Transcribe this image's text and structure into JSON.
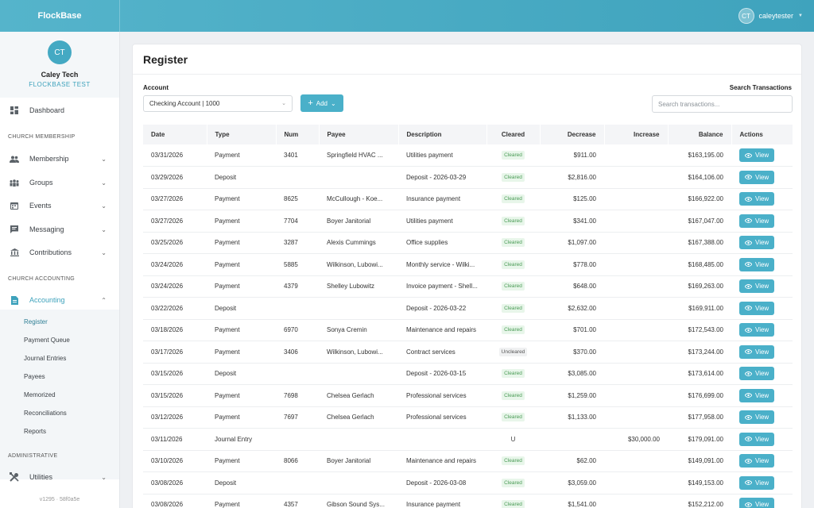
{
  "app": {
    "brand": "FlockBase"
  },
  "user": {
    "initials": "CT",
    "name": "caleytester"
  },
  "org": {
    "initials": "CT",
    "name": "Caley Tech",
    "subtitle": "FLOCKBASE TEST"
  },
  "nav": {
    "dashboard": "Dashboard",
    "sections": {
      "membership": "CHURCH MEMBERSHIP",
      "accounting": "CHURCH ACCOUNTING",
      "admin": "ADMINISTRATIVE"
    },
    "membership": "Membership",
    "groups": "Groups",
    "events": "Events",
    "messaging": "Messaging",
    "contributions": "Contributions",
    "accounting": "Accounting",
    "sub": [
      "Register",
      "Payment Queue",
      "Journal Entries",
      "Payees",
      "Memorized",
      "Reconciliations",
      "Reports"
    ],
    "utilities": "Utilities",
    "version": "v1295 · 58f0a5e"
  },
  "page": {
    "title": "Register",
    "account_label": "Account",
    "account_value": "Checking Account | 1000",
    "add_label": "Add",
    "search_label": "Search Transactions",
    "search_placeholder": "Search transactions..."
  },
  "table": {
    "headers": [
      "Date",
      "Type",
      "Num",
      "Payee",
      "Description",
      "Cleared",
      "Decrease",
      "Increase",
      "Balance",
      "Actions"
    ],
    "view_label": "View",
    "rows": [
      [
        "03/31/2026",
        "Payment",
        "3401",
        "Springfield HVAC ...",
        "Utilities payment",
        "Cleared",
        "$911.00",
        "",
        "$163,195.00"
      ],
      [
        "03/29/2026",
        "Deposit",
        "",
        "",
        "Deposit - 2026-03-29",
        "Cleared",
        "$2,816.00",
        "",
        "$164,106.00"
      ],
      [
        "03/27/2026",
        "Payment",
        "8625",
        "McCullough - Koe...",
        "Insurance payment",
        "Cleared",
        "$125.00",
        "",
        "$166,922.00"
      ],
      [
        "03/27/2026",
        "Payment",
        "7704",
        "Boyer Janitorial",
        "Utilities payment",
        "Cleared",
        "$341.00",
        "",
        "$167,047.00"
      ],
      [
        "03/25/2026",
        "Payment",
        "3287",
        "Alexis Cummings",
        "Office supplies",
        "Cleared",
        "$1,097.00",
        "",
        "$167,388.00"
      ],
      [
        "03/24/2026",
        "Payment",
        "5885",
        "Wilkinson, Lubowi...",
        "Monthly service - Wilki...",
        "Cleared",
        "$778.00",
        "",
        "$168,485.00"
      ],
      [
        "03/24/2026",
        "Payment",
        "4379",
        "Shelley Lubowitz",
        "Invoice payment - Shell...",
        "Cleared",
        "$648.00",
        "",
        "$169,263.00"
      ],
      [
        "03/22/2026",
        "Deposit",
        "",
        "",
        "Deposit - 2026-03-22",
        "Cleared",
        "$2,632.00",
        "",
        "$169,911.00"
      ],
      [
        "03/18/2026",
        "Payment",
        "6970",
        "Sonya Cremin",
        "Maintenance and repairs",
        "Cleared",
        "$701.00",
        "",
        "$172,543.00"
      ],
      [
        "03/17/2026",
        "Payment",
        "3406",
        "Wilkinson, Lubowi...",
        "Contract services",
        "Uncleared",
        "$370.00",
        "",
        "$173,244.00"
      ],
      [
        "03/15/2026",
        "Deposit",
        "",
        "",
        "Deposit - 2026-03-15",
        "Cleared",
        "$3,085.00",
        "",
        "$173,614.00"
      ],
      [
        "03/15/2026",
        "Payment",
        "7698",
        "Chelsea Gerlach",
        "Professional services",
        "Cleared",
        "$1,259.00",
        "",
        "$176,699.00"
      ],
      [
        "03/12/2026",
        "Payment",
        "7697",
        "Chelsea Gerlach",
        "Professional services",
        "Cleared",
        "$1,133.00",
        "",
        "$177,958.00"
      ],
      [
        "03/11/2026",
        "Journal Entry",
        "",
        "",
        "",
        "U",
        "",
        "$30,000.00",
        "$179,091.00"
      ],
      [
        "03/10/2026",
        "Payment",
        "8066",
        "Boyer Janitorial",
        "Maintenance and repairs",
        "Cleared",
        "$62.00",
        "",
        "$149,091.00"
      ],
      [
        "03/08/2026",
        "Deposit",
        "",
        "",
        "Deposit - 2026-03-08",
        "Cleared",
        "$3,059.00",
        "",
        "$149,153.00"
      ],
      [
        "03/08/2026",
        "Payment",
        "4357",
        "Gibson Sound Sys...",
        "Insurance payment",
        "Cleared",
        "$1,541.00",
        "",
        "$152,212.00"
      ]
    ]
  }
}
